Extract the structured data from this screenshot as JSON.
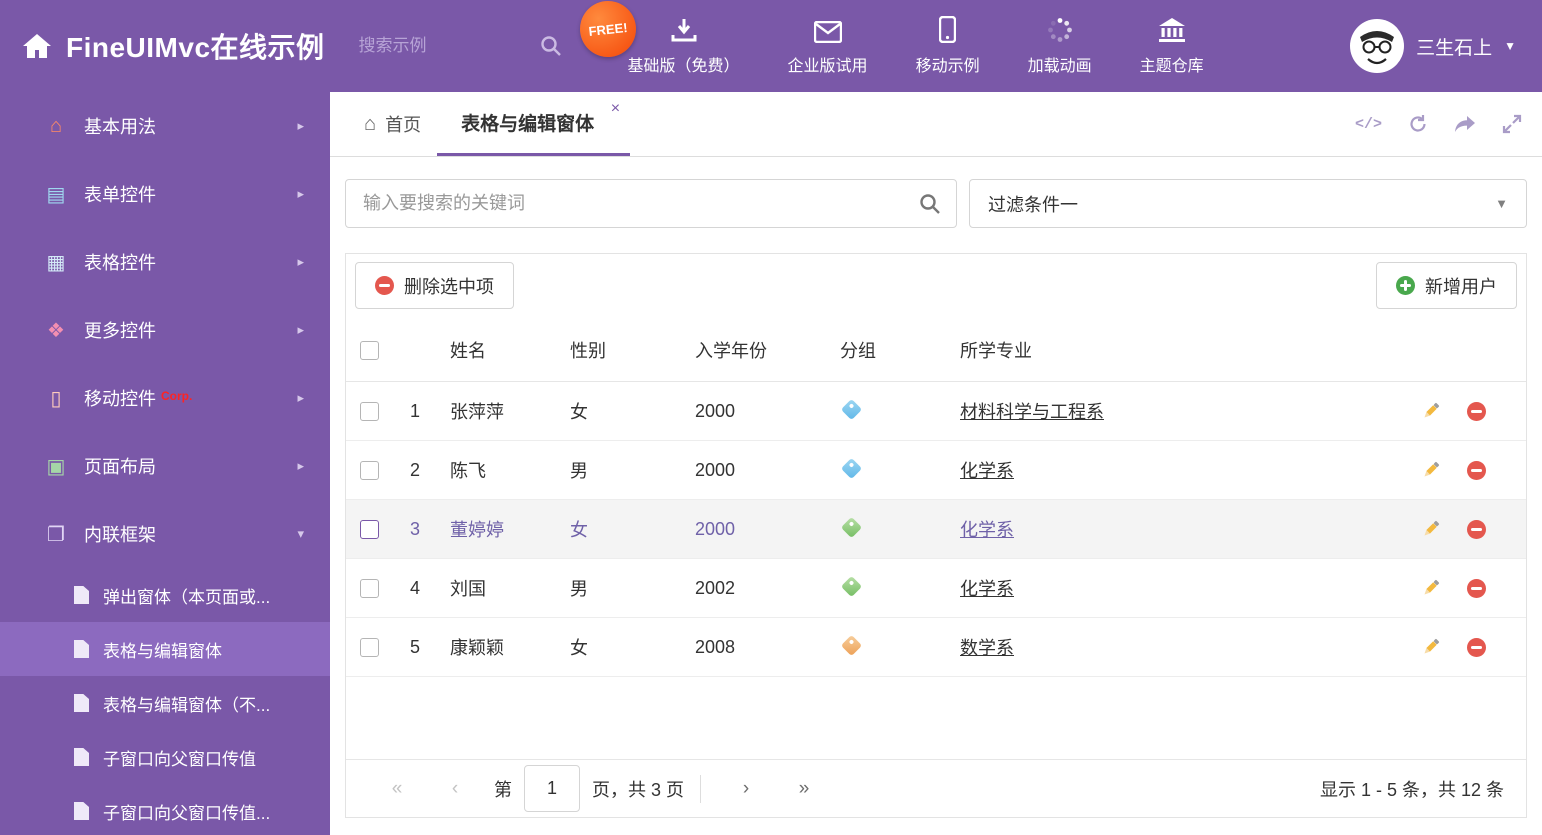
{
  "colors": {
    "brand_purple": "#7a58a8",
    "sidebar_active": "#8c6abf",
    "free_badge": "#f44708",
    "tag_blue": "#5fb7e8",
    "tag_green": "#74bd62",
    "tag_orange": "#eda055",
    "delete_red": "#e4574e",
    "add_green": "#49a84d",
    "corp_red": "#ff2323"
  },
  "header": {
    "title": "FineUIMvc在线示例",
    "search_placeholder": "搜索示例",
    "free_badge": "FREE!",
    "nav": [
      {
        "label": "基础版（免费）"
      },
      {
        "label": "企业版试用"
      },
      {
        "label": "移动示例"
      },
      {
        "label": "加载动画"
      },
      {
        "label": "主题仓库"
      }
    ],
    "user": "三生石上"
  },
  "sidebar": {
    "items": [
      {
        "label": "基本用法"
      },
      {
        "label": "表单控件"
      },
      {
        "label": "表格控件"
      },
      {
        "label": "更多控件"
      },
      {
        "label": "移动控件",
        "badge": "Corp."
      },
      {
        "label": "页面布局"
      },
      {
        "label": "内联框架"
      }
    ],
    "subitems": [
      {
        "label": "弹出窗体（本页面或..."
      },
      {
        "label": "表格与编辑窗体"
      },
      {
        "label": "表格与编辑窗体（不..."
      },
      {
        "label": "子窗口向父窗口传值"
      },
      {
        "label": "子窗口向父窗口传值..."
      }
    ]
  },
  "tabs": {
    "home_label": "首页",
    "active_label": "表格与编辑窗体"
  },
  "filter": {
    "search_placeholder": "输入要搜索的关键词",
    "dropdown_value": "过滤条件一"
  },
  "toolbar": {
    "delete_label": "删除选中项",
    "add_label": "新增用户"
  },
  "table": {
    "headers": {
      "name": "姓名",
      "gender": "性别",
      "year": "入学年份",
      "group": "分组",
      "major": "所学专业"
    },
    "rows": [
      {
        "num": "1",
        "name": "张萍萍",
        "gender": "女",
        "year": "2000",
        "major": "材料科学与工程系"
      },
      {
        "num": "2",
        "name": "陈飞",
        "gender": "男",
        "year": "2000",
        "major": "化学系"
      },
      {
        "num": "3",
        "name": "董婷婷",
        "gender": "女",
        "year": "2000",
        "major": "化学系"
      },
      {
        "num": "4",
        "name": "刘国",
        "gender": "男",
        "year": "2002",
        "major": "化学系"
      },
      {
        "num": "5",
        "name": "康颖颖",
        "gender": "女",
        "year": "2008",
        "major": "数学系"
      }
    ]
  },
  "pagination": {
    "prefix": "第",
    "page": "1",
    "suffix": "页，共 3 页",
    "summary": "显示 1 - 5 条，共 12 条"
  }
}
